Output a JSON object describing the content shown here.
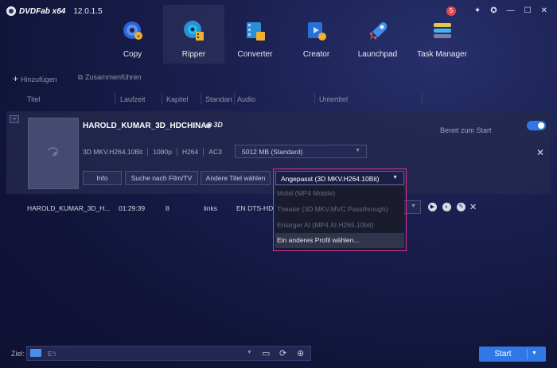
{
  "app": {
    "name": "DVDFab x64",
    "version": "12.0.1.5",
    "notification_count": "5"
  },
  "window_controls": [
    "✦",
    "✪",
    "—",
    "☐",
    "✕"
  ],
  "nav": [
    {
      "label": "Copy",
      "icon": "copy-disc-icon"
    },
    {
      "label": "Ripper",
      "icon": "ripper-disc-icon",
      "active": true
    },
    {
      "label": "Converter",
      "icon": "converter-film-icon"
    },
    {
      "label": "Creator",
      "icon": "creator-film-icon"
    },
    {
      "label": "Launchpad",
      "icon": "rocket-icon"
    },
    {
      "label": "Task Manager",
      "icon": "task-list-icon"
    }
  ],
  "toolbar": {
    "add": "Hinzufügen",
    "merge": "Zusammenführen"
  },
  "columns": [
    "Titel",
    "Laufzeit",
    "Kapitel",
    "Standard",
    "Audio",
    "Untertitel"
  ],
  "movie": {
    "title": "HAROLD_KUMAR_3D_HDCHINA",
    "disc_badge": "3D",
    "status": "Bereit zum Start",
    "enabled": true,
    "meta": [
      "3D MKV.H264.10Bit",
      "1080p",
      "H264",
      "AC3"
    ],
    "size": "5012 MB (Standard)",
    "buttons": {
      "info": "Info",
      "search": "Suche nach Film/TV",
      "other_titles": "Andere Titel wählen"
    }
  },
  "profile_dropdown": {
    "selected": "Angepasst (3D MKV.H264.10Bit)",
    "options": [
      {
        "label": "Mobil (MP4 Mobile)"
      },
      {
        "label": "Theater (3D MKV.MVC Passthrough)"
      },
      {
        "label": "Enlarger AI (MP4.AI.H265.10bit)"
      },
      {
        "label": "Ein anderes Profil wählen...",
        "highlighted": true
      }
    ]
  },
  "track": {
    "title": "HAROLD_KUMAR_3D_H...",
    "runtime": "01:29:39",
    "chapters": "8",
    "standard": "links",
    "audio": "EN  DTS-HD"
  },
  "destination": {
    "label": "Ziel:",
    "path": "E:\\"
  },
  "start": {
    "label": "Start"
  }
}
